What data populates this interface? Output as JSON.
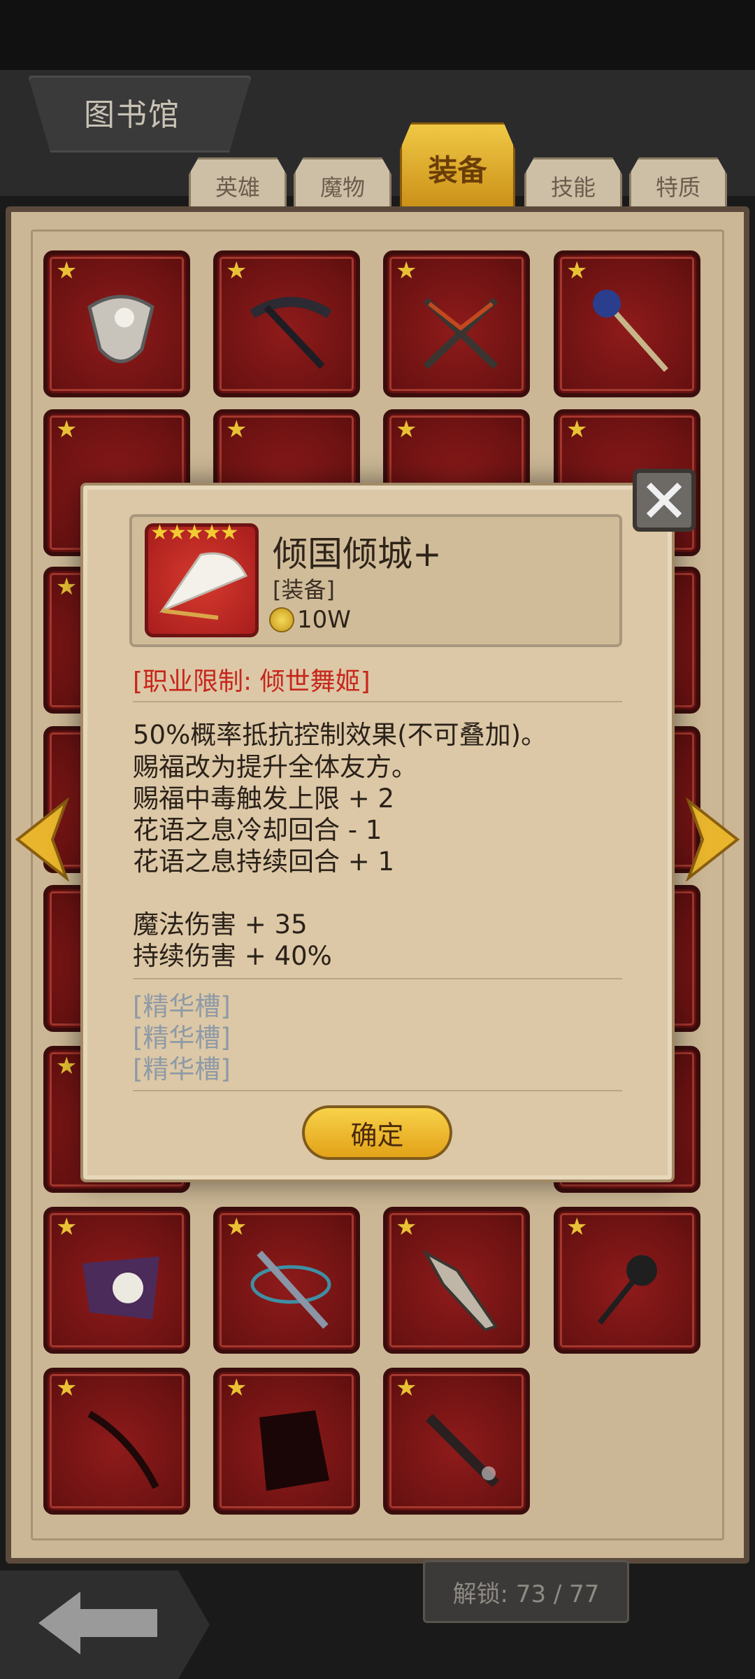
{
  "header": {
    "title": "图书馆"
  },
  "tabs": [
    {
      "label": "英雄",
      "active": false
    },
    {
      "label": "魔物",
      "active": false
    },
    {
      "label": "装备",
      "active": true
    },
    {
      "label": "技能",
      "active": false
    },
    {
      "label": "特质",
      "active": false
    }
  ],
  "grid": {
    "star_glyph": "★",
    "star_color": "#e8c234"
  },
  "footer": {
    "unlock_text": "解锁: 73 / 77"
  },
  "popup": {
    "item_name": "倾国倾城+",
    "item_type": "[装备]",
    "rarity_stars": 5,
    "stars_text": "★★★★★",
    "price": "10W",
    "restriction": "[职业限制: 倾世舞姬]",
    "description_lines": [
      "50%概率抵抗控制效果(不可叠加)。",
      "赐福改为提升全体友方。",
      "赐福中毒触发上限 + 2",
      "花语之息冷却回合 - 1",
      "花语之息持续回合 + 1"
    ],
    "stat_lines": [
      "魔法伤害 + 35",
      "持续伤害 + 40%"
    ],
    "essence_slots": [
      "[精华槽]",
      "[精华槽]",
      "[精华槽]"
    ],
    "confirm_label": "确定"
  },
  "colors": {
    "accent_gold": "#f2c334",
    "restriction_red": "#c7261d",
    "slot_red": "#8f1b1b"
  }
}
